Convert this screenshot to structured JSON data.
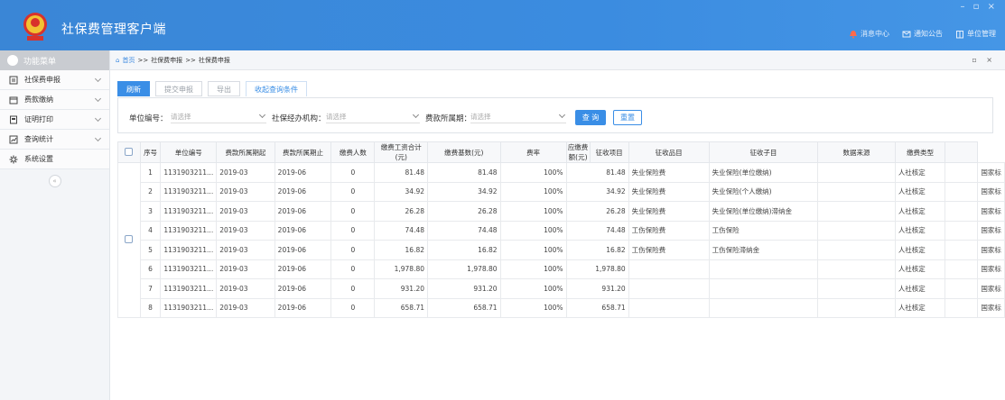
{
  "app": {
    "title": "社保费管理客户端",
    "window_controls": "– ▫ ×",
    "top_links": [
      "消息中心",
      "通知公告",
      "单位管理"
    ]
  },
  "sidebar": {
    "header": "功能菜单",
    "items": [
      {
        "label": "社保费申报",
        "icon": "document-icon"
      },
      {
        "label": "费款缴纳",
        "icon": "calendar-icon"
      },
      {
        "label": "证明打印",
        "icon": "print-doc-icon"
      },
      {
        "label": "查询统计",
        "icon": "chart-icon"
      },
      {
        "label": "系统设置",
        "icon": "gear-icon"
      }
    ],
    "collapse": "«"
  },
  "breadcrumb": {
    "items": [
      "首页",
      ">>",
      "社保费申报",
      ">>",
      "社保费申报"
    ],
    "controls": "▫ ×"
  },
  "toolbar": {
    "refresh": "刷新",
    "submit": "提交申报",
    "export": "导出",
    "collapse_query": "收起查询条件"
  },
  "filter": {
    "unit_code_label": "单位编号：",
    "unit_code_placeholder": "请选择",
    "agency_label": "社保经办机构：",
    "agency_placeholder": "请选择",
    "period_label": "费款所属期：",
    "period_placeholder": "请选择",
    "query": "查 询",
    "reset": "重置"
  },
  "table": {
    "headers": [
      "序号",
      "单位编号",
      "费款所属期起",
      "费款所属期止",
      "缴费人数",
      "缴费工资合计(元)",
      "缴费基数(元)",
      "费率",
      "应缴费额(元)",
      "征收项目",
      "征收品目",
      "征收子目",
      "数据来源",
      "缴费类型",
      ""
    ],
    "rows": [
      [
        "1",
        "1131903211...",
        "2019-03",
        "2019-06",
        "0",
        "81.48",
        "81.48",
        "100%",
        "81.48",
        "失业保险费",
        "失业保险(单位缴纳)",
        "",
        "人社核定",
        "",
        "国家标"
      ],
      [
        "2",
        "1131903211...",
        "2019-03",
        "2019-06",
        "0",
        "34.92",
        "34.92",
        "100%",
        "34.92",
        "失业保险费",
        "失业保险(个人缴纳)",
        "",
        "人社核定",
        "",
        "国家标"
      ],
      [
        "3",
        "1131903211...",
        "2019-03",
        "2019-06",
        "0",
        "26.28",
        "26.28",
        "100%",
        "26.28",
        "失业保险费",
        "失业保险(单位缴纳)滞纳金",
        "",
        "人社核定",
        "",
        "国家标"
      ],
      [
        "4",
        "1131903211...",
        "2019-03",
        "2019-06",
        "0",
        "74.48",
        "74.48",
        "100%",
        "74.48",
        "工伤保险费",
        "工伤保险",
        "",
        "人社核定",
        "",
        "国家标"
      ],
      [
        "5",
        "1131903211...",
        "2019-03",
        "2019-06",
        "0",
        "16.82",
        "16.82",
        "100%",
        "16.82",
        "工伤保险费",
        "工伤保险滞纳金",
        "",
        "人社核定",
        "",
        "国家标"
      ],
      [
        "6",
        "1131903211...",
        "2019-03",
        "2019-06",
        "0",
        "1,978.80",
        "1,978.80",
        "100%",
        "1,978.80",
        "",
        "",
        "",
        "人社核定",
        "",
        "国家标"
      ],
      [
        "7",
        "1131903211...",
        "2019-03",
        "2019-06",
        "0",
        "931.20",
        "931.20",
        "100%",
        "931.20",
        "",
        "",
        "",
        "人社核定",
        "",
        "国家标"
      ],
      [
        "8",
        "1131903211...",
        "2019-03",
        "2019-06",
        "0",
        "658.71",
        "658.71",
        "100%",
        "658.71",
        "",
        "",
        "",
        "人社核定",
        "",
        "国家标"
      ]
    ]
  },
  "colors": {
    "titlebar": "#3a86d6",
    "accent": "#3a8ee6",
    "logo_red": "#d8322b",
    "logo_gold": "#f2c233"
  }
}
